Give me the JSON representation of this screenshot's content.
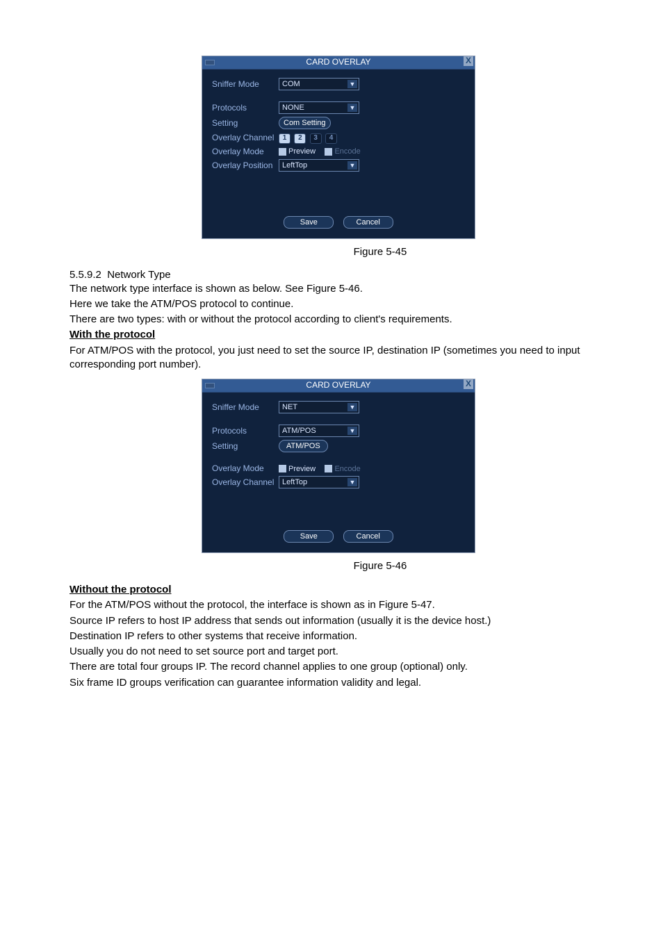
{
  "dialog1": {
    "title": "CARD OVERLAY",
    "rows": {
      "sniffer_label": "Sniffer Mode",
      "sniffer_value": "COM",
      "protocols_label": "Protocols",
      "protocols_value": "NONE",
      "setting_label": "Setting",
      "setting_btn": "Com Setting",
      "ov_channel_label": "Overlay Channel",
      "chan": [
        "1",
        "2",
        "3",
        "4"
      ],
      "ov_mode_label": "Overlay Mode",
      "preview": "Preview",
      "encode": "Encode",
      "ov_pos_label": "Overlay Position",
      "ov_pos_value": "LeftTop"
    },
    "save": "Save",
    "cancel": "Cancel"
  },
  "figcap1": "Figure 5-45",
  "sec": {
    "num": "5.5.9.2",
    "title": "Network Type"
  },
  "p1": "The network type interface is shown as below. See Figure 5-46.",
  "p2": "Here we take the ATM/POS protocol to continue.",
  "p3": "There are two types: with or without the protocol according to client's requirements.",
  "wp_heading": "With the protocol",
  "p4": "For ATM/POS with the protocol, you just need to set the source IP, destination IP (sometimes you need to input corresponding port number).",
  "dialog2": {
    "title": "CARD OVERLAY",
    "rows": {
      "sniffer_label": "Sniffer Mode",
      "sniffer_value": "NET",
      "protocols_label": "Protocols",
      "protocols_value": "ATM/POS",
      "setting_label": "Setting",
      "setting_btn": "ATM/POS",
      "ov_mode_label": "Overlay Mode",
      "preview": "Preview",
      "encode": "Encode",
      "ov_channel_label": "Overlay Channel",
      "ov_channel_value": "LeftTop"
    },
    "save": "Save",
    "cancel": "Cancel"
  },
  "figcap2": "Figure 5-46",
  "wop_heading": "Without the protocol",
  "p5": "For the ATM/POS without the protocol, the interface is shown as in Figure 5-47.",
  "p6": "Source IP refers to host IP address that sends out information (usually it is the device host.)",
  "p7": "Destination IP refers to other systems that receive information.",
  "p8": "Usually you do not need to set source port and target port.",
  "p9": "There are total four groups IP. The record channel applies to one group (optional) only.",
  "p10": "Six frame ID groups verification can guarantee information validity and legal."
}
